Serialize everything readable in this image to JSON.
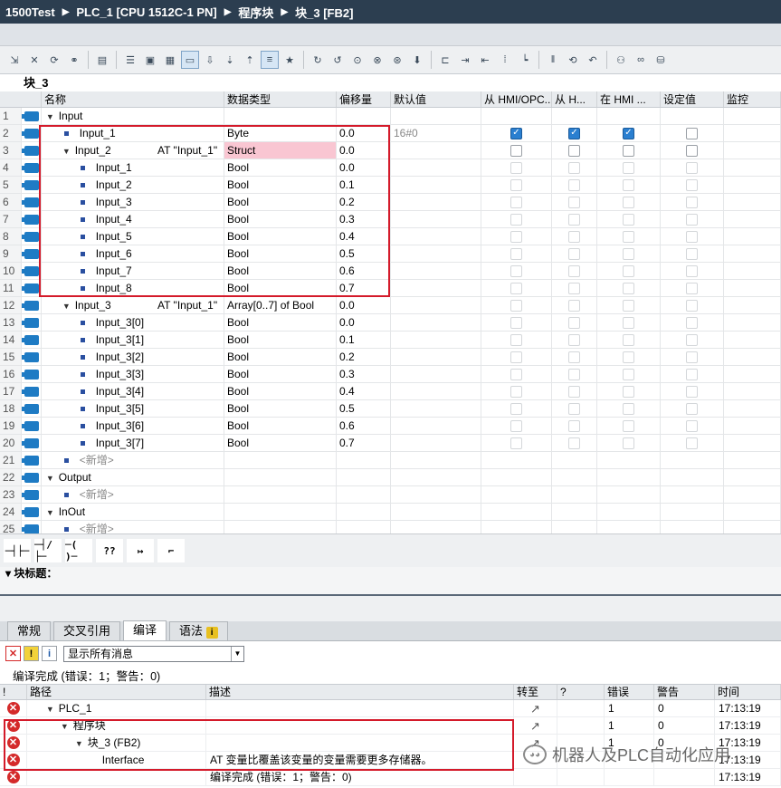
{
  "breadcrumb": [
    "1500Test",
    "PLC_1 [CPU 1512C-1 PN]",
    "程序块",
    "块_3 [FB2]"
  ],
  "toolbar_icons": [
    "insert-row-icon",
    "delete-row-icon",
    "rename-icon",
    "monitor-icon",
    "paste-icon",
    "network-list-icon",
    "collapse-icon",
    "expand-icon",
    "comment-icon",
    "insert-network-icon",
    "download-icon",
    "upload-icon",
    "abs-icon",
    "favorites-icon",
    "go-to-icon",
    "step-icon",
    "breakpoint-icon",
    "reference-icon",
    "trace-icon",
    "open-icon",
    "call-icon",
    "clear-icon",
    "watch-icon",
    "force-icon",
    "monitor-all-icon",
    "settings-icon",
    "glasses-icon",
    "database-icon"
  ],
  "block_title": "块_3",
  "columns": {
    "name": "名称",
    "type": "数据类型",
    "offset": "偏移量",
    "default": "默认值",
    "hmi1": "从 HMI/OPC...",
    "hmi2": "从 H...",
    "hmi3": "在 HMI ...",
    "setpoint": "设定值",
    "monitor": "监控"
  },
  "rows": [
    {
      "n": "1",
      "level": 0,
      "tri": "▼",
      "icon": true,
      "name": "Input",
      "at": "",
      "type": "",
      "offset": "",
      "def": "",
      "h1": false,
      "h2": false,
      "h3": false,
      "dim": true
    },
    {
      "n": "2",
      "level": 1,
      "tri": "",
      "icon": true,
      "name": "Input_1",
      "at": "",
      "type": "Byte",
      "offset": "0.0",
      "def": "16#0",
      "h1": true,
      "h2": true,
      "h3": true,
      "dim": false
    },
    {
      "n": "3",
      "level": 1,
      "tri": "▼",
      "icon": true,
      "name": "Input_2",
      "at": "AT \"Input_1\"",
      "type": "Struct",
      "pink": true,
      "offset": "0.0",
      "def": "",
      "h1": false,
      "h2": false,
      "h3": false,
      "dim": false
    },
    {
      "n": "4",
      "level": 2,
      "tri": "",
      "icon": true,
      "name": "Input_1",
      "at": "",
      "type": "Bool",
      "offset": "0.0",
      "def": "",
      "h1": false,
      "h2": false,
      "h3": false,
      "dim": true
    },
    {
      "n": "5",
      "level": 2,
      "tri": "",
      "icon": true,
      "name": "Input_2",
      "at": "",
      "type": "Bool",
      "offset": "0.1",
      "def": "",
      "h1": false,
      "h2": false,
      "h3": false,
      "dim": true
    },
    {
      "n": "6",
      "level": 2,
      "tri": "",
      "icon": true,
      "name": "Input_3",
      "at": "",
      "type": "Bool",
      "offset": "0.2",
      "def": "",
      "h1": false,
      "h2": false,
      "h3": false,
      "dim": true
    },
    {
      "n": "7",
      "level": 2,
      "tri": "",
      "icon": true,
      "name": "Input_4",
      "at": "",
      "type": "Bool",
      "offset": "0.3",
      "def": "",
      "h1": false,
      "h2": false,
      "h3": false,
      "dim": true
    },
    {
      "n": "8",
      "level": 2,
      "tri": "",
      "icon": true,
      "name": "Input_5",
      "at": "",
      "type": "Bool",
      "offset": "0.4",
      "def": "",
      "h1": false,
      "h2": false,
      "h3": false,
      "dim": true
    },
    {
      "n": "9",
      "level": 2,
      "tri": "",
      "icon": true,
      "name": "Input_6",
      "at": "",
      "type": "Bool",
      "offset": "0.5",
      "def": "",
      "h1": false,
      "h2": false,
      "h3": false,
      "dim": true
    },
    {
      "n": "10",
      "level": 2,
      "tri": "",
      "icon": true,
      "name": "Input_7",
      "at": "",
      "type": "Bool",
      "offset": "0.6",
      "def": "",
      "h1": false,
      "h2": false,
      "h3": false,
      "dim": true
    },
    {
      "n": "11",
      "level": 2,
      "tri": "",
      "icon": true,
      "name": "Input_8",
      "at": "",
      "type": "Bool",
      "offset": "0.7",
      "def": "",
      "h1": false,
      "h2": false,
      "h3": false,
      "dim": true
    },
    {
      "n": "12",
      "level": 1,
      "tri": "▼",
      "icon": true,
      "name": "Input_3",
      "at": "AT \"Input_1\"",
      "type": "Array[0..7] of Bool",
      "offset": "0.0",
      "def": "",
      "h1": false,
      "h2": false,
      "h3": false,
      "dim": true
    },
    {
      "n": "13",
      "level": 2,
      "tri": "",
      "icon": true,
      "name": "Input_3[0]",
      "at": "",
      "type": "Bool",
      "offset": "0.0",
      "def": "",
      "h1": false,
      "h2": false,
      "h3": false,
      "dim": true
    },
    {
      "n": "14",
      "level": 2,
      "tri": "",
      "icon": true,
      "name": "Input_3[1]",
      "at": "",
      "type": "Bool",
      "offset": "0.1",
      "def": "",
      "h1": false,
      "h2": false,
      "h3": false,
      "dim": true
    },
    {
      "n": "15",
      "level": 2,
      "tri": "",
      "icon": true,
      "name": "Input_3[2]",
      "at": "",
      "type": "Bool",
      "offset": "0.2",
      "def": "",
      "h1": false,
      "h2": false,
      "h3": false,
      "dim": true
    },
    {
      "n": "16",
      "level": 2,
      "tri": "",
      "icon": true,
      "name": "Input_3[3]",
      "at": "",
      "type": "Bool",
      "offset": "0.3",
      "def": "",
      "h1": false,
      "h2": false,
      "h3": false,
      "dim": true
    },
    {
      "n": "17",
      "level": 2,
      "tri": "",
      "icon": true,
      "name": "Input_3[4]",
      "at": "",
      "type": "Bool",
      "offset": "0.4",
      "def": "",
      "h1": false,
      "h2": false,
      "h3": false,
      "dim": true
    },
    {
      "n": "18",
      "level": 2,
      "tri": "",
      "icon": true,
      "name": "Input_3[5]",
      "at": "",
      "type": "Bool",
      "offset": "0.5",
      "def": "",
      "h1": false,
      "h2": false,
      "h3": false,
      "dim": true
    },
    {
      "n": "19",
      "level": 2,
      "tri": "",
      "icon": true,
      "name": "Input_3[6]",
      "at": "",
      "type": "Bool",
      "offset": "0.6",
      "def": "",
      "h1": false,
      "h2": false,
      "h3": false,
      "dim": true
    },
    {
      "n": "20",
      "level": 2,
      "tri": "",
      "icon": true,
      "name": "Input_3[7]",
      "at": "",
      "type": "Bool",
      "offset": "0.7",
      "def": "",
      "h1": false,
      "h2": false,
      "h3": false,
      "dim": true
    },
    {
      "n": "21",
      "level": 1,
      "tri": "",
      "icon": false,
      "name": "<新增>",
      "newitem": true,
      "at": "",
      "type": "",
      "offset": "",
      "def": "",
      "h1": false,
      "h2": false,
      "h3": false,
      "dim": true
    },
    {
      "n": "22",
      "level": 0,
      "tri": "▼",
      "icon": true,
      "name": "Output",
      "at": "",
      "type": "",
      "offset": "",
      "def": "",
      "h1": false,
      "h2": false,
      "h3": false,
      "dim": true
    },
    {
      "n": "23",
      "level": 1,
      "tri": "",
      "icon": false,
      "name": "<新增>",
      "newitem": true,
      "at": "",
      "type": "",
      "offset": "",
      "def": "",
      "h1": false,
      "h2": false,
      "h3": false,
      "dim": true
    },
    {
      "n": "24",
      "level": 0,
      "tri": "▼",
      "icon": true,
      "name": "InOut",
      "at": "",
      "type": "",
      "offset": "",
      "def": "",
      "h1": false,
      "h2": false,
      "h3": false,
      "dim": true
    },
    {
      "n": "25",
      "level": 1,
      "tri": "",
      "icon": false,
      "name": "<新增>",
      "newitem": true,
      "at": "",
      "type": "",
      "offset": "",
      "def": "",
      "h1": false,
      "h2": false,
      "h3": false,
      "dim": true
    }
  ],
  "ladder": [
    "─┤├─",
    "─┤/├─",
    "─( )─",
    "??",
    "↦",
    "⌐"
  ],
  "block_header": "▾ 块标题：",
  "tabs": [
    "常规",
    "交叉引用",
    "编译",
    "语法"
  ],
  "filter_value": "显示所有消息",
  "compile_summary": "编译完成 (错误：1；警告：0)",
  "msg_columns": {
    "path": "路径",
    "desc": "描述",
    "goto": "转至",
    "q": "?",
    "err": "错误",
    "warn": "警告",
    "time": "时间"
  },
  "messages": [
    {
      "path": "PLC_1",
      "indent": 1,
      "tri": "▼",
      "desc": "",
      "goto": "↗",
      "err": "1",
      "warn": "0",
      "time": "17:13:19"
    },
    {
      "path": "程序块",
      "indent": 2,
      "tri": "▼",
      "desc": "",
      "goto": "↗",
      "err": "1",
      "warn": "0",
      "time": "17:13:19"
    },
    {
      "path": "块_3 (FB2)",
      "indent": 3,
      "tri": "▼",
      "desc": "",
      "goto": "↗",
      "err": "1",
      "warn": "0",
      "time": "17:13:19"
    },
    {
      "path": "Interface",
      "indent": 4,
      "tri": "",
      "desc": "AT 变量比覆盖该变量的变量需要更多存储器。",
      "goto": "",
      "err": "",
      "warn": "",
      "time": "17:13:19"
    },
    {
      "path": "",
      "indent": 0,
      "tri": "",
      "desc": "编译完成 (错误：1；警告：0)",
      "goto": "",
      "err": "",
      "warn": "",
      "time": "17:13:19"
    }
  ],
  "watermark": "机器人及PLC自动化应用",
  "accent_red": "#d41a2a"
}
